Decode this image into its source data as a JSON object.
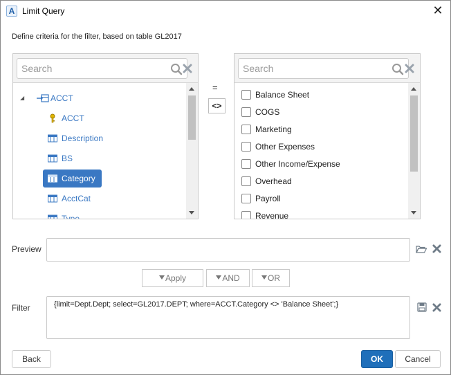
{
  "window": {
    "title": "Limit Query",
    "app_icon_letter": "A",
    "close_icon": "close-icon"
  },
  "heading": "Define criteria for the filter, based on table GL2017",
  "left_panel": {
    "search_placeholder": "Search",
    "tree": {
      "root": {
        "label": "ACCT",
        "icon": "table-link-icon",
        "expanded": true
      },
      "children": [
        {
          "label": "ACCT",
          "icon": "key-icon",
          "selected": false
        },
        {
          "label": "Description",
          "icon": "column-icon",
          "selected": false
        },
        {
          "label": "BS",
          "icon": "column-icon",
          "selected": false
        },
        {
          "label": "Category",
          "icon": "column-icon",
          "selected": true
        },
        {
          "label": "AcctCat",
          "icon": "column-icon",
          "selected": false
        },
        {
          "label": "Type",
          "icon": "column-icon",
          "selected": false
        }
      ]
    }
  },
  "operators": {
    "equals": "=",
    "not_equals": "<>"
  },
  "right_panel": {
    "search_placeholder": "Search",
    "values": [
      {
        "label": "Balance Sheet",
        "checked": false
      },
      {
        "label": "COGS",
        "checked": false
      },
      {
        "label": "Marketing",
        "checked": false
      },
      {
        "label": "Other Expenses",
        "checked": false
      },
      {
        "label": "Other Income/Expense",
        "checked": false
      },
      {
        "label": "Overhead",
        "checked": false
      },
      {
        "label": "Payroll",
        "checked": false
      },
      {
        "label": "Revenue",
        "checked": false
      }
    ]
  },
  "preview": {
    "label": "Preview",
    "value": ""
  },
  "filter_buttons": {
    "apply": "Apply",
    "and": "AND",
    "or": "OR"
  },
  "filter": {
    "label": "Filter",
    "value": "{limit=Dept.Dept; select=GL2017.DEPT; where=ACCT.Category <> 'Balance Sheet';}"
  },
  "footer": {
    "back": "Back",
    "ok": "OK",
    "cancel": "Cancel"
  },
  "colors": {
    "accent": "#3a78c3",
    "primary_button": "#1f6fba",
    "clear_icon": "#9aa3ad",
    "folder_icon": "#6f7c88"
  }
}
